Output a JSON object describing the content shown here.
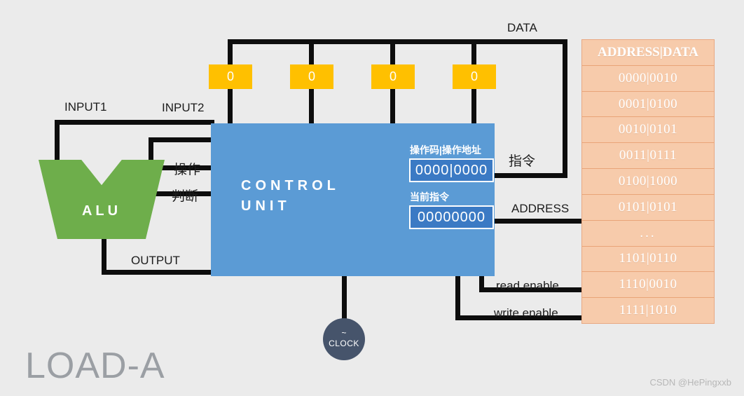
{
  "title": "LOAD-A",
  "watermark": "CSDN @HePingxxb",
  "colors": {
    "background": "#ebebeb",
    "alu": "#6eae4b",
    "control_unit": "#5b9bd5",
    "register": "#ffc000",
    "memory": "#f7cbab",
    "clock": "#46546b",
    "wire": "#0d0d0d",
    "title_text": "#9b9fa4"
  },
  "alu": {
    "label": "ALU",
    "inputs": [
      "INPUT1",
      "INPUT2"
    ],
    "output": "OUTPUT",
    "control_lines": [
      "操作",
      "判断"
    ]
  },
  "control_unit": {
    "title": "CONTROL\nUNIT",
    "fields": [
      {
        "label": "操作码|操作地址",
        "value": "0000|0000"
      },
      {
        "label": "当前指令",
        "value": "00000000"
      }
    ]
  },
  "registers": [
    {
      "value": "0"
    },
    {
      "value": "0"
    },
    {
      "value": "0"
    },
    {
      "value": "0"
    }
  ],
  "buses": {
    "data": "DATA",
    "instruction": "指令",
    "address": "ADDRESS",
    "read_enable": "read enable",
    "write_enable": "write enable"
  },
  "clock": {
    "wave": "~",
    "label": "CLOCK"
  },
  "memory": {
    "header": "ADDRESS|DATA",
    "rows": [
      "0000|0010",
      "0001|0100",
      "0010|0101",
      "0011|0111",
      "0100|1000",
      "0101|0101",
      "...",
      "1101|0110",
      "1110|0010",
      "1111|1010"
    ]
  }
}
